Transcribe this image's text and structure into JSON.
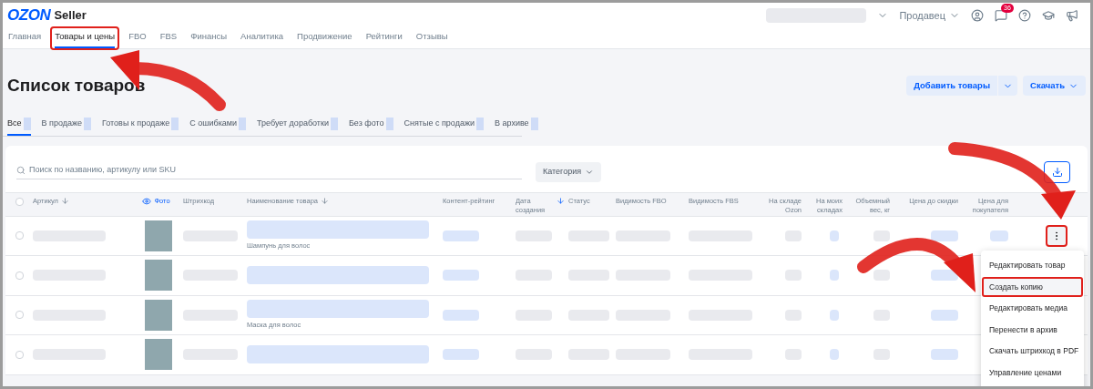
{
  "header": {
    "logo": "OZON",
    "product": "Seller",
    "account_menu": "Продавец",
    "notifications_badge": "36"
  },
  "nav": [
    {
      "label": "Главная",
      "selected": false,
      "highlighted": false
    },
    {
      "label": "Товары и цены",
      "selected": true,
      "highlighted": true
    },
    {
      "label": "FBO",
      "selected": false,
      "highlighted": false
    },
    {
      "label": "FBS",
      "selected": false,
      "highlighted": false
    },
    {
      "label": "Финансы",
      "selected": false,
      "highlighted": false
    },
    {
      "label": "Аналитика",
      "selected": false,
      "highlighted": false
    },
    {
      "label": "Продвижение",
      "selected": false,
      "highlighted": false
    },
    {
      "label": "Рейтинги",
      "selected": false,
      "highlighted": false
    },
    {
      "label": "Отзывы",
      "selected": false,
      "highlighted": false
    }
  ],
  "page_title": "Список товаров",
  "actions": [
    {
      "label": "Добавить товары",
      "split": true
    },
    {
      "label": "Скачать",
      "split": false
    }
  ],
  "filter_tabs": [
    {
      "label": "Все",
      "selected": true
    },
    {
      "label": "В продаже",
      "selected": false
    },
    {
      "label": "Готовы к продаже",
      "selected": false
    },
    {
      "label": "С ошибками",
      "selected": false
    },
    {
      "label": "Требует доработки",
      "selected": false
    },
    {
      "label": "Без фото",
      "selected": false
    },
    {
      "label": "Снятые с продажи",
      "selected": false
    },
    {
      "label": "В архиве",
      "selected": false
    }
  ],
  "search": {
    "placeholder": "Поиск по названию, артикулу или SKU"
  },
  "category_filter": "Категория",
  "table": {
    "all_checked": false,
    "columns": [
      {
        "label": "Артикул",
        "sort_active": false,
        "eye": false
      },
      {
        "label": "Фото",
        "eye": true
      },
      {
        "label": "Штрихкод",
        "eye": false
      },
      {
        "label": "Наименование товара",
        "sort_active": false,
        "eye": false
      },
      {
        "label": "Контент-рейтинг",
        "eye": false
      },
      {
        "label": "Дата создания",
        "sort_active": true,
        "eye": false
      },
      {
        "label": "Статус",
        "eye": false
      },
      {
        "label": "Видимость FBO",
        "eye": false
      },
      {
        "label": "Видимость FBS",
        "eye": false
      },
      {
        "label": "На складе Ozon",
        "eye": false
      },
      {
        "label": "На моих складах",
        "eye": false
      },
      {
        "label": "Объемный вес, кг",
        "eye": false
      },
      {
        "label": "Цена до скидки",
        "eye": false
      },
      {
        "label": "Цена для покупателя",
        "eye": false
      }
    ],
    "rows": [
      {
        "checked": false,
        "subtitle": "Шампунь для волос"
      },
      {
        "checked": false
      },
      {
        "checked": false,
        "subtitle": "Маска для волос"
      },
      {
        "checked": false
      }
    ]
  },
  "row_menu": {
    "open": true,
    "items": [
      {
        "label": "Редактировать товар",
        "highlighted": false
      },
      {
        "label": "Создать копию",
        "highlighted": true
      },
      {
        "label": "Редактировать медиа",
        "highlighted": false
      },
      {
        "label": "Перенести в архив",
        "highlighted": false
      },
      {
        "label": "Скачать штрихкод в PDF",
        "highlighted": false
      },
      {
        "label": "Управление ценами",
        "highlighted": false
      }
    ]
  }
}
